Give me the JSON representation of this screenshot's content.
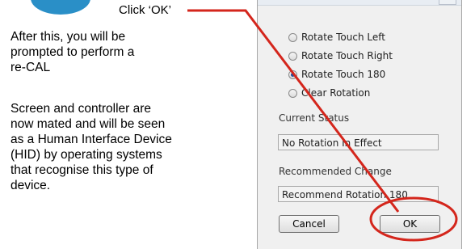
{
  "callout": {
    "text": "Click ‘OK’"
  },
  "instructions": {
    "paragraph1_lines": [
      "After this, you will be",
      "prompted to perform a",
      "re-CAL"
    ],
    "paragraph2_lines": [
      "Screen and controller are",
      "now mated and will be seen",
      "as a Human Interface Device",
      "(HID) by operating systems",
      "that recognise this type of",
      "device."
    ]
  },
  "dialog": {
    "options": [
      {
        "label": "Rotate Touch Left",
        "checked": false
      },
      {
        "label": "Rotate Touch Right",
        "checked": false
      },
      {
        "label": "Rotate Touch 180",
        "checked": true
      },
      {
        "label": "Clear Rotation",
        "checked": false
      }
    ],
    "current_status_label": "Current Status",
    "current_status_value": "No Rotation In Effect",
    "recommended_label": "Recommended Change",
    "recommended_value": "Recommend Rotation 180",
    "cancel_label": "Cancel",
    "ok_label": "OK"
  },
  "colors": {
    "annotation_red": "#d4261c",
    "step_circle_blue": "#2a8fc7"
  }
}
